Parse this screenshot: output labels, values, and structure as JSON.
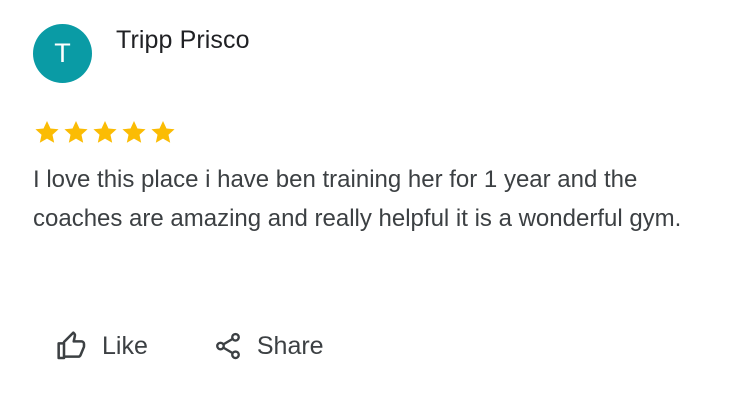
{
  "review": {
    "author": {
      "initial": "T",
      "name": "Tripp Prisco",
      "avatar_color": "#0a9ba5"
    },
    "rating": 5,
    "rating_max": 5,
    "star_color": "#fbbc04",
    "text": "I love this place i have ben training her for 1 year and the coaches are amazing and really helpful it is a wonderful gym.",
    "actions": {
      "like_label": "Like",
      "like_icon": "thumbs-up-icon",
      "share_label": "Share",
      "share_icon": "share-icon"
    }
  }
}
